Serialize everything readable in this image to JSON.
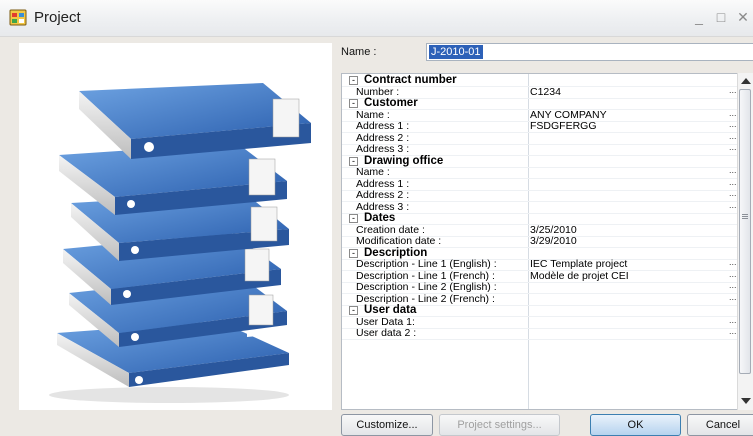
{
  "window": {
    "title": "Project",
    "minimize_glyph": "_",
    "maximize_glyph": "□",
    "close_glyph": "✕"
  },
  "name_field": {
    "label": "Name :",
    "value": "J-2010-01"
  },
  "properties": [
    {
      "type": "group",
      "label": "Contract number",
      "expander": "-"
    },
    {
      "type": "item",
      "label": "Number :",
      "value": "C1234",
      "editor": "..."
    },
    {
      "type": "group",
      "label": "Customer",
      "expander": "-"
    },
    {
      "type": "item",
      "label": "Name :",
      "value": "ANY COMPANY",
      "editor": "..."
    },
    {
      "type": "item",
      "label": "Address 1 :",
      "value": "FSDGFERGG",
      "editor": "..."
    },
    {
      "type": "item",
      "label": "Address 2 :",
      "value": "",
      "editor": "..."
    },
    {
      "type": "item",
      "label": "Address 3 :",
      "value": "",
      "editor": "..."
    },
    {
      "type": "group",
      "label": "Drawing office",
      "expander": "-"
    },
    {
      "type": "item",
      "label": "Name :",
      "value": "",
      "editor": "..."
    },
    {
      "type": "item",
      "label": "Address 1 :",
      "value": "",
      "editor": "..."
    },
    {
      "type": "item",
      "label": "Address 2 :",
      "value": "",
      "editor": "..."
    },
    {
      "type": "item",
      "label": "Address 3 :",
      "value": "",
      "editor": "..."
    },
    {
      "type": "group",
      "label": "Dates",
      "expander": "-"
    },
    {
      "type": "item",
      "label": "Creation date :",
      "value": "3/25/2010",
      "editor": ""
    },
    {
      "type": "item",
      "label": "Modification date :",
      "value": "3/29/2010",
      "editor": ""
    },
    {
      "type": "group",
      "label": "Description",
      "expander": "-"
    },
    {
      "type": "item",
      "label": "Description - Line 1 (English) :",
      "value": "IEC Template project",
      "editor": "..."
    },
    {
      "type": "item",
      "label": "Description - Line 1 (French) :",
      "value": "Modèle de projet CEI",
      "editor": "..."
    },
    {
      "type": "item",
      "label": "Description - Line 2 (English) :",
      "value": "",
      "editor": "..."
    },
    {
      "type": "item",
      "label": "Description - Line 2 (French) :",
      "value": "",
      "editor": "..."
    },
    {
      "type": "group",
      "label": "User data",
      "expander": "-"
    },
    {
      "type": "item",
      "label": "User Data 1:",
      "value": "",
      "editor": "..."
    },
    {
      "type": "item",
      "label": "User data 2 :",
      "value": "",
      "editor": "..."
    }
  ],
  "buttons": {
    "customize": "Customize...",
    "project_settings": "Project settings...",
    "ok": "OK",
    "cancel": "Cancel"
  },
  "colors": {
    "selection": "#2d61b8",
    "binder_blue": "#3f78c8",
    "default_button": "#b6d3ef"
  }
}
